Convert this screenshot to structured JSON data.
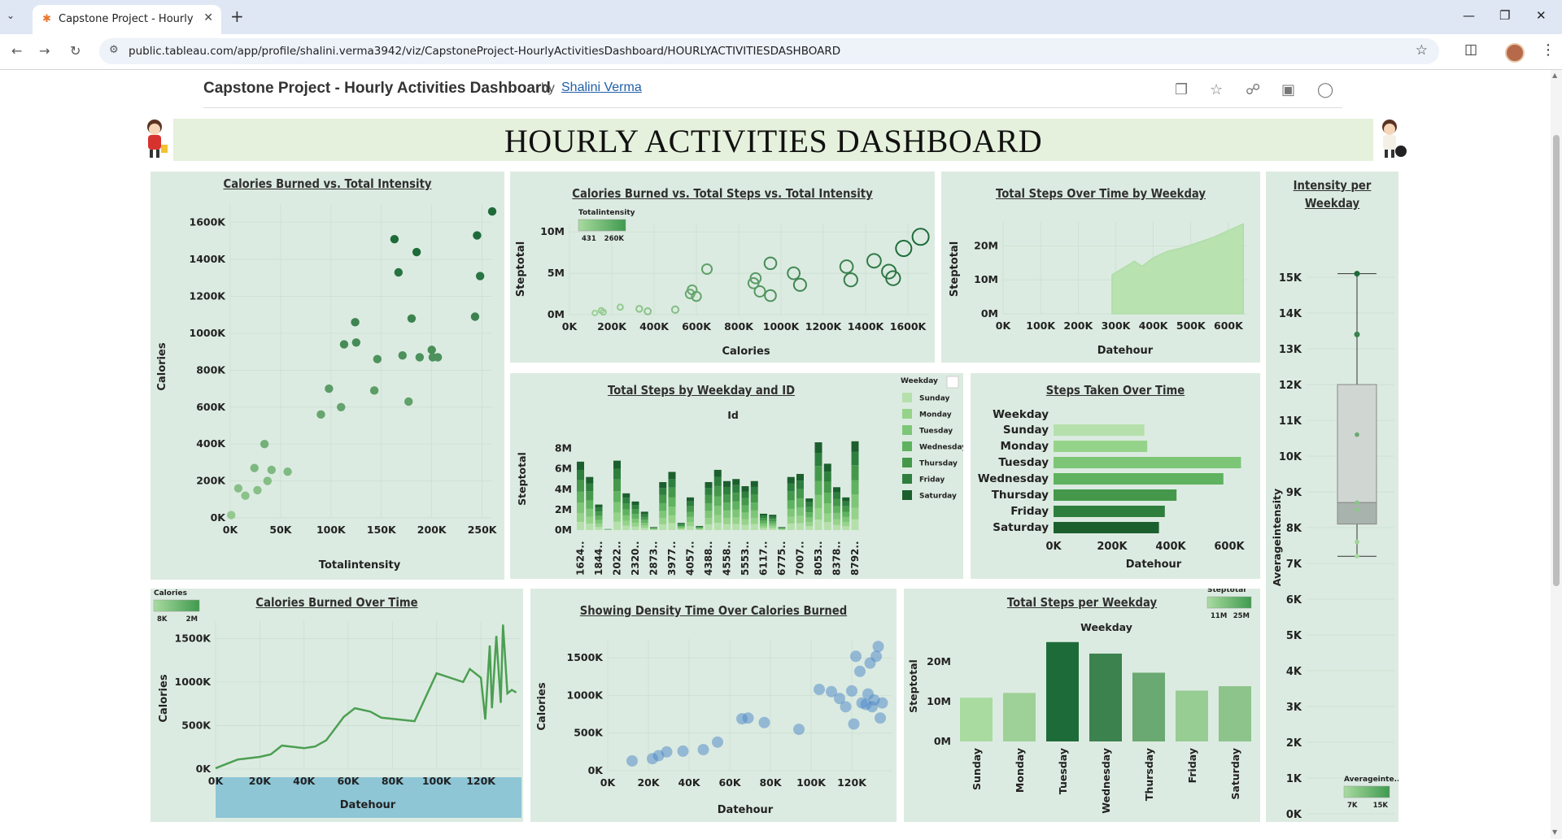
{
  "browser": {
    "tab_title": "Capstone Project - Hourly Activi",
    "url": "public.tableau.com/app/profile/shalini.verma3942/viz/CapstoneProject-HourlyActivitiesDashboard/HOURLYACTIVITIESDASHBOARD"
  },
  "viz_header": {
    "title": "Capstone Project - Hourly Activities Dashboard",
    "by": "by",
    "author": "Shalini Verma"
  },
  "dashboard": {
    "banner_title": "HOURLY ACTIVITIES DASHBOARD"
  },
  "colors": {
    "dark_green": "#1e6b3a",
    "mid_green": "#3f9a4e",
    "light_green": "#a9dba0",
    "panel_bg": "#dcebe1",
    "banner_bg": "#e5f1dc",
    "density_blue": "#4a86c8"
  },
  "chart_data": [
    {
      "id": "calories-vs-intensity",
      "type": "scatter",
      "title": "Calories Burned vs. Total Intensity",
      "xlabel": "Totalintensity",
      "ylabel": "Calories",
      "xlim": [
        0,
        260000
      ],
      "ylim": [
        0,
        1700000
      ],
      "x_ticks": [
        "0K",
        "50K",
        "100K",
        "150K",
        "200K",
        "250K"
      ],
      "y_ticks": [
        "0K",
        "200K",
        "400K",
        "600K",
        "800K",
        "1000K",
        "1200K",
        "1400K",
        "1600K"
      ],
      "points": [
        [
          1000,
          15000
        ],
        [
          8000,
          160000
        ],
        [
          15000,
          120000
        ],
        [
          24000,
          270000
        ],
        [
          27000,
          150000
        ],
        [
          34000,
          400000
        ],
        [
          37000,
          200000
        ],
        [
          41000,
          260000
        ],
        [
          57000,
          250000
        ],
        [
          90000,
          560000
        ],
        [
          98000,
          700000
        ],
        [
          110000,
          600000
        ],
        [
          113000,
          940000
        ],
        [
          124000,
          1060000
        ],
        [
          125000,
          950000
        ],
        [
          143000,
          690000
        ],
        [
          146000,
          860000
        ],
        [
          163000,
          1510000
        ],
        [
          167000,
          1330000
        ],
        [
          171000,
          880000
        ],
        [
          177000,
          630000
        ],
        [
          180000,
          1080000
        ],
        [
          185000,
          1440000
        ],
        [
          188000,
          870000
        ],
        [
          200000,
          910000
        ],
        [
          201000,
          870000
        ],
        [
          206000,
          870000
        ],
        [
          243000,
          1090000
        ],
        [
          245000,
          1530000
        ],
        [
          248000,
          1310000
        ],
        [
          260000,
          1660000
        ]
      ]
    },
    {
      "id": "calories-steps-intensity",
      "type": "scatter",
      "title": "Calories Burned vs. Total Steps vs. Total Intensity",
      "legend_title": "Totalintensity",
      "legend_min": "431",
      "legend_max": "260K",
      "xlabel": "Calories",
      "ylabel": "Steptotal",
      "xlim": [
        0,
        1700000
      ],
      "ylim": [
        0,
        11000000
      ],
      "x_ticks": [
        "0K",
        "200K",
        "400K",
        "600K",
        "800K",
        "1000K",
        "1200K",
        "1400K",
        "1600K"
      ],
      "y_ticks": [
        "0M",
        "5M",
        "10M"
      ],
      "points": [
        [
          120000,
          200000,
          431
        ],
        [
          150000,
          500000,
          8000
        ],
        [
          160000,
          300000,
          10000
        ],
        [
          240000,
          900000,
          15000
        ],
        [
          330000,
          700000,
          27000
        ],
        [
          370000,
          400000,
          34000
        ],
        [
          500000,
          600000,
          41000
        ],
        [
          570000,
          2500000,
          90000
        ],
        [
          580000,
          3000000,
          98000
        ],
        [
          600000,
          2200000,
          100000
        ],
        [
          650000,
          5500000,
          113000
        ],
        [
          870000,
          3800000,
          124000
        ],
        [
          880000,
          4400000,
          125000
        ],
        [
          900000,
          2800000,
          130000
        ],
        [
          950000,
          2300000,
          143000
        ],
        [
          1060000,
          5000000,
          163000
        ],
        [
          950000,
          6200000,
          160000
        ],
        [
          1090000,
          3600000,
          170000
        ],
        [
          1310000,
          5800000,
          180000
        ],
        [
          1330000,
          4200000,
          190000
        ],
        [
          1440000,
          6500000,
          200000
        ],
        [
          1510000,
          5200000,
          206000
        ],
        [
          1530000,
          4400000,
          210000
        ],
        [
          1580000,
          8000000,
          243000
        ],
        [
          1660000,
          9400000,
          260000
        ]
      ]
    },
    {
      "id": "steps-over-time-weekday",
      "type": "area",
      "title": "Total Steps Over Time by Weekday",
      "xlabel": "Datehour",
      "ylabel": "Steptotal",
      "xlim": [
        0,
        650000
      ],
      "ylim": [
        0,
        27000000
      ],
      "x_ticks": [
        "0K",
        "100K",
        "200K",
        "300K",
        "400K",
        "500K",
        "600K"
      ],
      "y_ticks": [
        "0M",
        "10M",
        "20M"
      ],
      "x": [
        290000,
        320000,
        350000,
        370000,
        400000,
        440000,
        480000,
        520000,
        560000,
        600000,
        640000
      ],
      "values": [
        11500000,
        13500000,
        15500000,
        14000000,
        16500000,
        18500000,
        19500000,
        21000000,
        22500000,
        24500000,
        26500000
      ]
    },
    {
      "id": "intensity-per-weekday",
      "type": "box",
      "title": "Intensity per Weekday",
      "ylabel": "Averageintensity",
      "legend_title": "Averageinte...",
      "legend_min": "7K",
      "legend_max": "15K",
      "ylim": [
        0,
        15500
      ],
      "y_ticks": [
        "0K",
        "1K",
        "2K",
        "3K",
        "4K",
        "5K",
        "6K",
        "7K",
        "8K",
        "9K",
        "10K",
        "11K",
        "12K",
        "13K",
        "14K",
        "15K"
      ],
      "whisker_low": 7200,
      "q1": 8100,
      "median": 8700,
      "q3": 12000,
      "whisker_high": 15100,
      "points": [
        7200,
        7600,
        8500,
        8700,
        10600,
        13400,
        15100
      ]
    },
    {
      "id": "steps-by-weekday-id",
      "type": "bar",
      "stacked": true,
      "title": "Total Steps by Weekday and ID",
      "header": "Id",
      "ylabel": "Steptotal",
      "ylim": [
        0,
        9000000
      ],
      "y_ticks": [
        "0M",
        "2M",
        "4M",
        "6M",
        "8M"
      ],
      "x_ticks": [
        "1624..",
        "1844..",
        "2022..",
        "2320..",
        "2873..",
        "3977..",
        "4057..",
        "4388..",
        "4558..",
        "5553..",
        "6117..",
        "6775..",
        "7007..",
        "8053..",
        "8378..",
        "8792.."
      ],
      "legend_title": "Weekday",
      "legend": [
        "Sunday",
        "Monday",
        "Tuesday",
        "Wednesday",
        "Thursday",
        "Friday",
        "Saturday"
      ],
      "totals": [
        6700000,
        5200000,
        2500000,
        100000,
        6800000,
        3600000,
        2800000,
        1800000,
        300000,
        4700000,
        5700000,
        700000,
        3200000,
        400000,
        4700000,
        5900000,
        4800000,
        5000000,
        4300000,
        4800000,
        1600000,
        1500000,
        300000,
        5200000,
        5500000,
        3100000,
        8600000,
        6500000,
        4200000,
        3200000,
        8700000
      ]
    },
    {
      "id": "steps-taken-over-time",
      "type": "bar",
      "orientation": "horizontal",
      "title": "Steps Taken Over Time",
      "header": "Weekday",
      "xlabel": "Datehour",
      "xlim": [
        0,
        650000
      ],
      "x_ticks": [
        "0K",
        "200K",
        "400K",
        "600K"
      ],
      "categories": [
        "Sunday",
        "Monday",
        "Tuesday",
        "Wednesday",
        "Thursday",
        "Friday",
        "Saturday"
      ],
      "values": [
        310000,
        320000,
        640000,
        580000,
        420000,
        380000,
        360000
      ]
    },
    {
      "id": "calories-over-time",
      "type": "line",
      "title": "Calories Burned Over Time",
      "legend_title": "Calories",
      "legend_min": "8K",
      "legend_max": "2M",
      "xlabel": "Datehour",
      "ylabel": "Calories",
      "xlim": [
        0,
        138000
      ],
      "ylim": [
        0,
        1700000
      ],
      "x_ticks": [
        "0K",
        "20K",
        "40K",
        "60K",
        "80K",
        "100K",
        "120K"
      ],
      "y_ticks": [
        "0K",
        "500K",
        "1000K",
        "1500K"
      ],
      "x": [
        0,
        10000,
        20000,
        25000,
        30000,
        40000,
        45000,
        50000,
        58000,
        63000,
        70000,
        75000,
        90000,
        100000,
        112000,
        115000,
        120000,
        122000,
        124000,
        125000,
        127000,
        129000,
        130000,
        132000,
        134000,
        136000
      ],
      "values": [
        10000,
        110000,
        140000,
        170000,
        270000,
        240000,
        260000,
        330000,
        600000,
        700000,
        660000,
        590000,
        550000,
        1100000,
        1000000,
        1150000,
        1050000,
        570000,
        1420000,
        700000,
        1530000,
        760000,
        1660000,
        870000,
        910000,
        880000
      ]
    },
    {
      "id": "density-time-calories",
      "type": "scatter",
      "title": "Showing Density Time Over Calories Burned",
      "xlabel": "Datehour",
      "ylabel": "Calories",
      "xlim": [
        0,
        140000
      ],
      "ylim": [
        0,
        1750000
      ],
      "x_ticks": [
        "0K",
        "20K",
        "40K",
        "60K",
        "80K",
        "100K",
        "120K"
      ],
      "y_ticks": [
        "0K",
        "500K",
        "1000K",
        "1500K"
      ],
      "points": [
        [
          12000,
          130000
        ],
        [
          22000,
          160000
        ],
        [
          25000,
          200000
        ],
        [
          29000,
          250000
        ],
        [
          37000,
          260000
        ],
        [
          47000,
          280000
        ],
        [
          54000,
          380000
        ],
        [
          66000,
          690000
        ],
        [
          69000,
          700000
        ],
        [
          77000,
          640000
        ],
        [
          94000,
          550000
        ],
        [
          104000,
          1080000
        ],
        [
          110000,
          1050000
        ],
        [
          114000,
          960000
        ],
        [
          117000,
          850000
        ],
        [
          120000,
          1060000
        ],
        [
          121000,
          620000
        ],
        [
          122000,
          1520000
        ],
        [
          124000,
          1320000
        ],
        [
          125000,
          900000
        ],
        [
          127000,
          880000
        ],
        [
          128000,
          1020000
        ],
        [
          129000,
          1430000
        ],
        [
          130000,
          850000
        ],
        [
          131000,
          940000
        ],
        [
          132000,
          1520000
        ],
        [
          133000,
          1650000
        ],
        [
          134000,
          700000
        ],
        [
          135000,
          900000
        ]
      ]
    },
    {
      "id": "steps-per-weekday",
      "type": "bar",
      "title": "Total Steps per Weekday",
      "header": "Weekday",
      "legend_title": "Steptotal",
      "legend_min": "11M",
      "legend_max": "25M",
      "ylabel": "Steptotal",
      "ylim": [
        0,
        27000000
      ],
      "y_ticks": [
        "0M",
        "10M",
        "20M"
      ],
      "categories": [
        "Sunday",
        "Monday",
        "Tuesday",
        "Wednesday",
        "Thursday",
        "Friday",
        "Saturday"
      ],
      "values": [
        11000000,
        12200000,
        25000000,
        22100000,
        17300000,
        12800000,
        13900000
      ]
    }
  ]
}
